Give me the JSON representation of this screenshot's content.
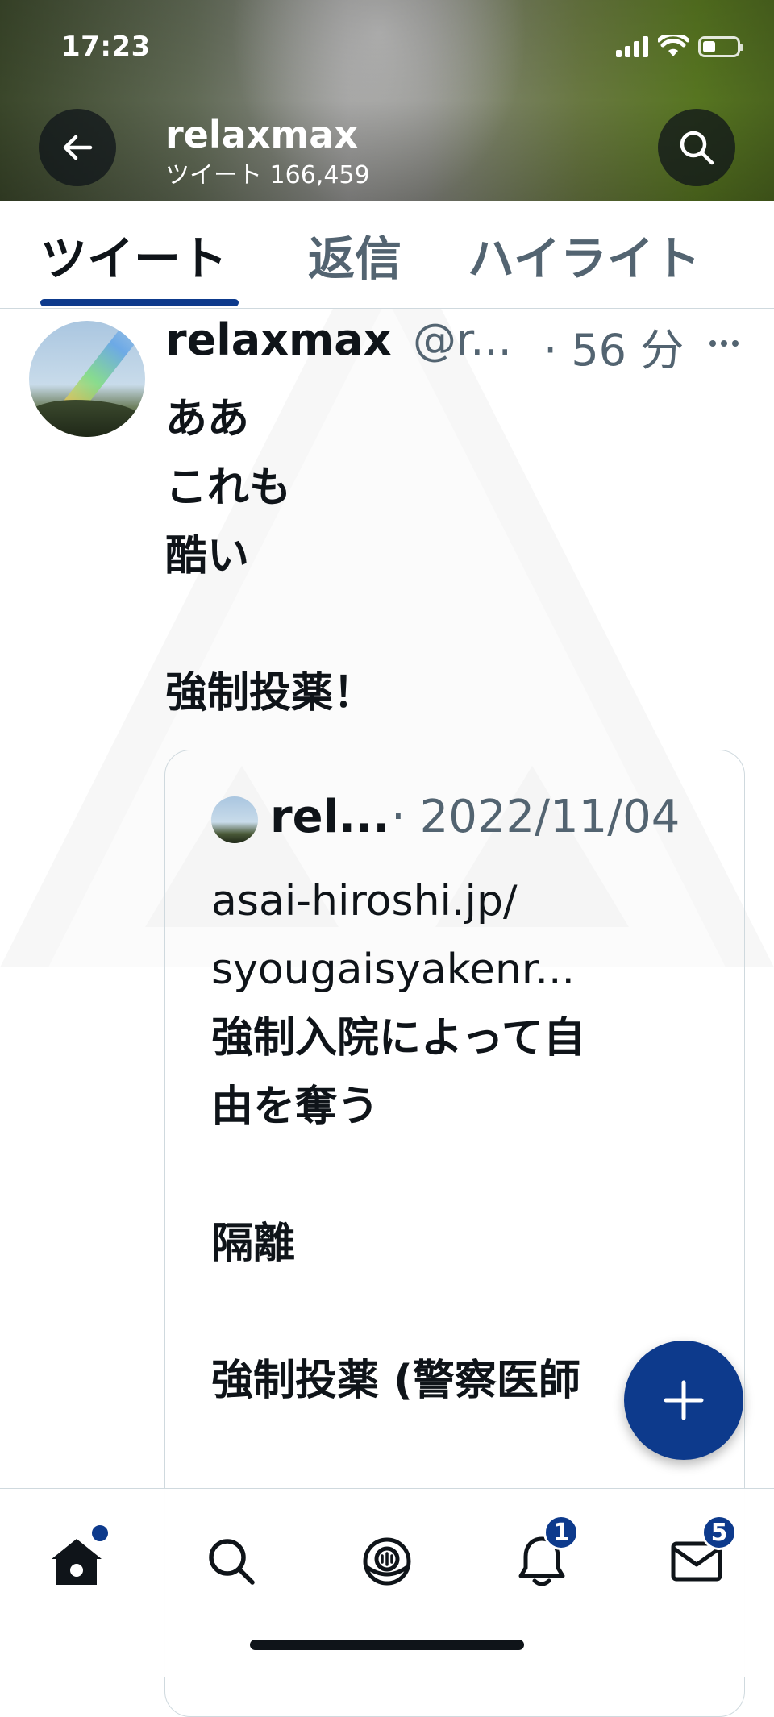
{
  "status_bar": {
    "time": "17:23"
  },
  "header": {
    "title": "relaxmax",
    "subtitle": "ツイート 166,459"
  },
  "tabs": [
    {
      "label": "ツイート",
      "active": true
    },
    {
      "label": "返信",
      "active": false
    },
    {
      "label": "ハイライト",
      "active": false
    }
  ],
  "tweet": {
    "name": "relaxmax",
    "handle": "@r...",
    "time": "· 56 分",
    "text": "ああ\nこれも\n酷い\n\n強制投薬！",
    "quote": {
      "name": "rel...",
      "date": "· 2022/11/04",
      "link": "asai-hiroshi.jp/\nsyougaisyakenr...",
      "text": "強制入院によって自\n由を奪う\n\n隔離\n\n強制投薬 (警察医師"
    }
  },
  "bottom_nav": {
    "items": [
      "home-icon",
      "search-icon",
      "spaces-icon",
      "notifications-icon",
      "messages-icon"
    ],
    "notifications_badge": "1",
    "messages_badge": "5"
  },
  "colors": {
    "accent": "#0d3a8c",
    "secondary_text": "#536471",
    "border": "#cfd9de"
  }
}
